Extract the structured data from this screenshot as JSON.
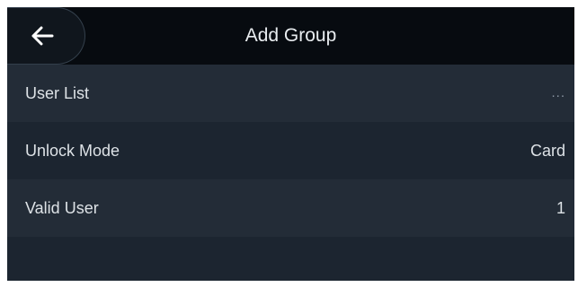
{
  "header": {
    "title": "Add Group",
    "back_icon": "arrow-left-icon"
  },
  "settings": {
    "rows": [
      {
        "label": "User List",
        "value": "..."
      },
      {
        "label": "Unlock Mode",
        "value": "Card"
      },
      {
        "label": "Valid User",
        "value": "1"
      }
    ]
  },
  "colors": {
    "header_background": "#070b10",
    "row_background_dark": "#1c2530",
    "row_background_light": "#232c37",
    "text": "#dde2e6"
  }
}
